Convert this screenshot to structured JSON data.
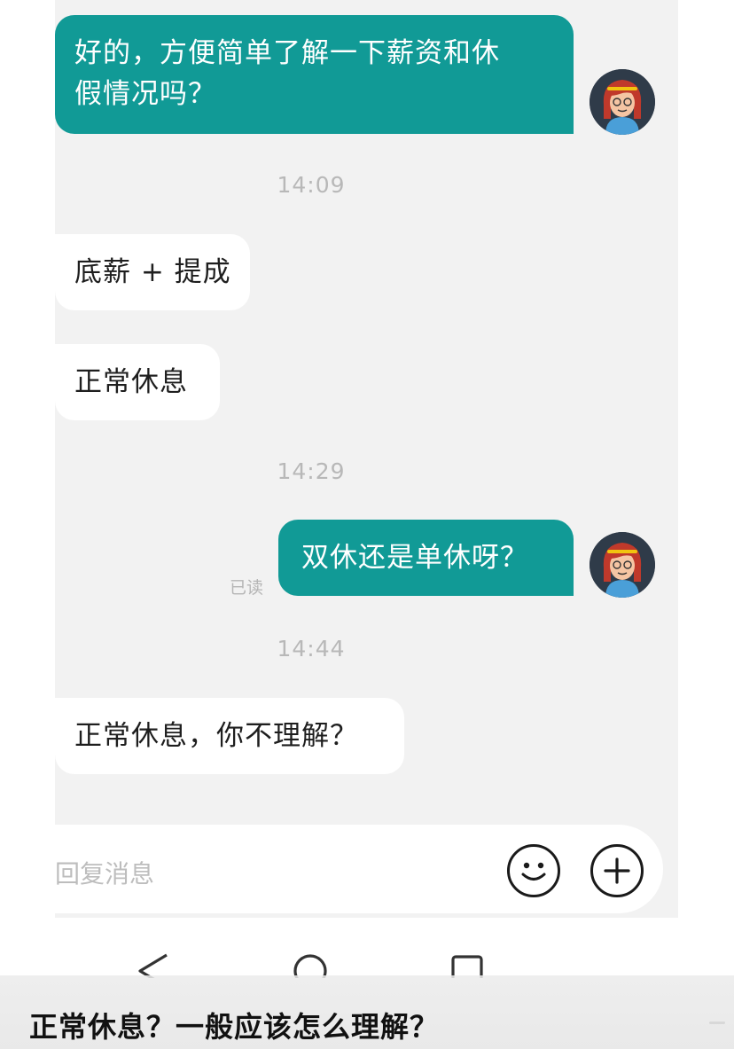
{
  "messages": [
    {
      "type": "sent",
      "text_line1": "好的，方便简单了解一下薪资和休",
      "text_line2": "假情况吗？"
    },
    {
      "type": "time",
      "text": "14:09"
    },
    {
      "type": "received",
      "text": "底薪 + 提成"
    },
    {
      "type": "received",
      "text": "正常休息"
    },
    {
      "type": "time",
      "text": "14:29"
    },
    {
      "type": "sent",
      "text": "双休还是单休呀？",
      "status": "已读"
    },
    {
      "type": "time",
      "text": "14:44"
    },
    {
      "type": "received",
      "text": "正常休息，你不理解？"
    }
  ],
  "input": {
    "placeholder": "回复消息"
  },
  "icons": {
    "emoji": "smiley-icon",
    "add": "plus-circle-icon",
    "back": "back-triangle-icon",
    "home": "home-circle-icon",
    "recents": "recents-square-icon"
  },
  "caption": "正常休息？一般应该怎么理解？",
  "colors": {
    "sent_bubble": "#119a96",
    "chat_bg": "#f2f2f2",
    "time_text": "#b8b8b8"
  }
}
